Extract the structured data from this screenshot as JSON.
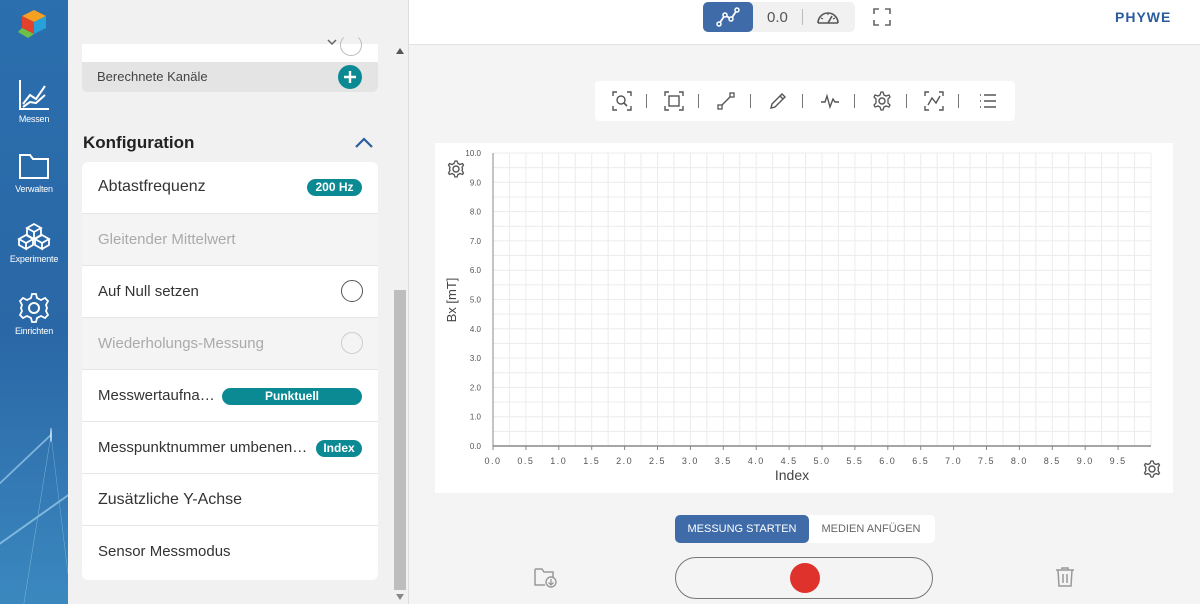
{
  "nav": {
    "items": [
      {
        "label": "Messen",
        "icon": "line-chart-icon"
      },
      {
        "label": "Verwalten",
        "icon": "folder-icon"
      },
      {
        "label": "Experimente",
        "icon": "cubes-icon"
      },
      {
        "label": "Einrichten",
        "icon": "gear-icon"
      }
    ]
  },
  "panel": {
    "channels_label": "Berechnete Kanäle",
    "config_title": "Konfiguration",
    "rows": [
      {
        "label": "Abtastfrequenz",
        "badge": "200 Hz"
      },
      {
        "label": "Gleitender Mittelwert"
      },
      {
        "label": "Auf Null setzen"
      },
      {
        "label": "Wiederholungs-Messung"
      },
      {
        "label": "Messwertaufna…",
        "badge": "Punktuell"
      },
      {
        "label": "Messpunktnummer umbenen…",
        "badge": "Index"
      },
      {
        "label": "Zusätzliche Y-Achse"
      },
      {
        "label": "Sensor Messmodus"
      }
    ]
  },
  "topbar": {
    "value": "0.0",
    "brand": "PHYWE"
  },
  "chart_data": {
    "type": "line",
    "xlabel": "Index",
    "ylabel": "Bx [mT]",
    "xlim": [
      0,
      10
    ],
    "ylim": [
      0,
      10
    ],
    "x_ticks": [
      "0.0",
      "0.5",
      "1.0",
      "1.5",
      "2.0",
      "2.5",
      "3.0",
      "3.5",
      "4.0",
      "4.5",
      "5.0",
      "5.5",
      "6.0",
      "6.5",
      "7.0",
      "7.5",
      "8.0",
      "8.5",
      "9.0",
      "9.5"
    ],
    "y_ticks": [
      "0.0",
      "1.0",
      "2.0",
      "3.0",
      "4.0",
      "5.0",
      "6.0",
      "7.0",
      "8.0",
      "9.0",
      "10.0"
    ],
    "grid": true,
    "series": []
  },
  "controls": {
    "start_label": "MESSUNG STARTEN",
    "media_label": "MEDIEN ANFÜGEN"
  }
}
